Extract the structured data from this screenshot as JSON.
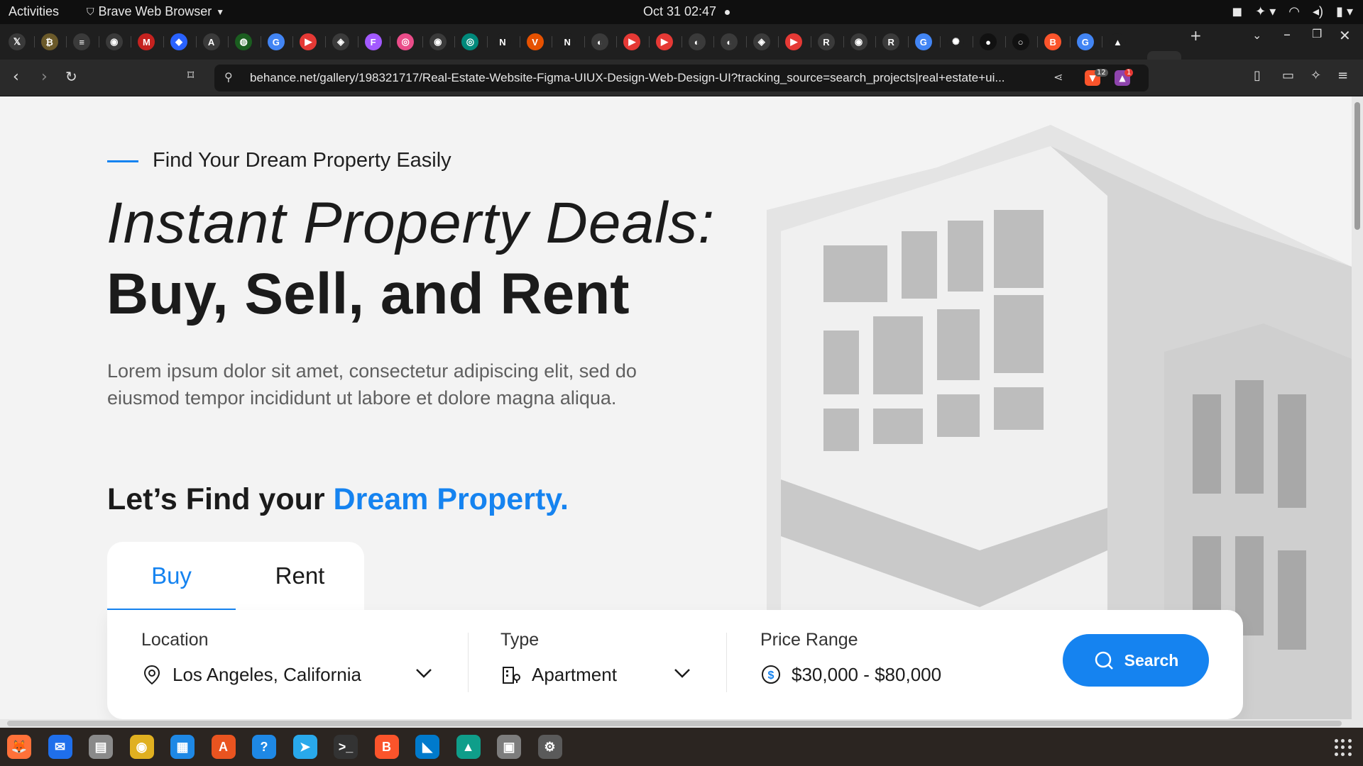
{
  "system_bar": {
    "activities": "Activities",
    "app_name": "Brave Web Browser",
    "clock": "Oct 31  02:47"
  },
  "browser": {
    "url": "behance.net/gallery/198321717/Real-Estate-Website-Figma-UIUX-Design-Web-Design-UI?tracking_source=search_projects|real+estate+ui...",
    "shields_count": "12",
    "rewards_count": "1",
    "close_tab_glyph": "✕",
    "new_tab_glyph": "+"
  },
  "tab_icons": [
    {
      "name": "x-icon",
      "glyph": "𝕏",
      "color": "#3a3a3a"
    },
    {
      "name": "coin-icon",
      "glyph": "₿",
      "color": "#6b5a2a"
    },
    {
      "name": "stack-icon",
      "glyph": "≡",
      "color": "#3a3a3a"
    },
    {
      "name": "chrome-icon",
      "glyph": "◉",
      "color": "#3a3a3a"
    },
    {
      "name": "gmail-icon",
      "glyph": "M",
      "color": "#c5221f"
    },
    {
      "name": "bluebird-icon",
      "glyph": "◆",
      "color": "#2962ff"
    },
    {
      "name": "circle-a-icon",
      "glyph": "A",
      "color": "#3a3a3a"
    },
    {
      "name": "green-icon",
      "glyph": "◍",
      "color": "#1b5e20"
    },
    {
      "name": "google-icon",
      "glyph": "G",
      "color": "#4285f4"
    },
    {
      "name": "youtube-icon",
      "glyph": "▶",
      "color": "#e53935"
    },
    {
      "name": "app-icon",
      "glyph": "◈",
      "color": "#3a3a3a"
    },
    {
      "name": "figma-icon",
      "glyph": "F",
      "color": "#a259ff"
    },
    {
      "name": "dribbble-icon",
      "glyph": "◎",
      "color": "#ea4c89"
    },
    {
      "name": "chrome-icon",
      "glyph": "◉",
      "color": "#3a3a3a"
    },
    {
      "name": "teal-icon",
      "glyph": "◎",
      "color": "#00897b"
    },
    {
      "name": "notion-icon",
      "glyph": "N",
      "color": "#1f1f1f"
    },
    {
      "name": "v-icon",
      "glyph": "V",
      "color": "#e65100"
    },
    {
      "name": "notion-icon",
      "glyph": "N",
      "color": "#1f1f1f"
    },
    {
      "name": "github-icon",
      "glyph": "◐",
      "color": "#3a3a3a"
    },
    {
      "name": "youtube-icon",
      "glyph": "▶",
      "color": "#e53935"
    },
    {
      "name": "youtube-icon",
      "glyph": "▶",
      "color": "#e53935"
    },
    {
      "name": "github-icon",
      "glyph": "◐",
      "color": "#3a3a3a"
    },
    {
      "name": "github-icon",
      "glyph": "◐",
      "color": "#3a3a3a"
    },
    {
      "name": "app-icon",
      "glyph": "◈",
      "color": "#3a3a3a"
    },
    {
      "name": "youtube-icon",
      "glyph": "▶",
      "color": "#e53935"
    },
    {
      "name": "r-icon",
      "glyph": "R",
      "color": "#3a3a3a"
    },
    {
      "name": "chrome-icon",
      "glyph": "◉",
      "color": "#3a3a3a"
    },
    {
      "name": "r-icon",
      "glyph": "R",
      "color": "#3a3a3a"
    },
    {
      "name": "google-icon",
      "glyph": "G",
      "color": "#4285f4"
    },
    {
      "name": "openai-icon",
      "glyph": "✺",
      "color": "#1f1f1f"
    },
    {
      "name": "dark-icon",
      "glyph": "●",
      "color": "#111111"
    },
    {
      "name": "dark-icon",
      "glyph": "○",
      "color": "#111111"
    },
    {
      "name": "brave-icon",
      "glyph": "B",
      "color": "#fb542b"
    },
    {
      "name": "google-icon",
      "glyph": "G",
      "color": "#4285f4"
    },
    {
      "name": "triangle-icon",
      "glyph": "▲",
      "color": "#1f1f1f"
    }
  ],
  "hero": {
    "eyebrow": "Find Your Dream Property Easily",
    "headline_italic": "Instant Property Deals:",
    "headline_bold": "Buy, Sell, and Rent",
    "paragraph": "Lorem ipsum dolor sit amet, consectetur adipiscing elit, sed do eiusmod tempor incididunt ut labore et dolore magna aliqua.",
    "find_prefix": "Let’s Find your ",
    "find_accent": "Dream Property."
  },
  "tabs": [
    {
      "label": "Buy",
      "active": true
    },
    {
      "label": "Rent",
      "active": false
    }
  ],
  "search": {
    "location_label": "Location",
    "location_value": "Los Angeles, California",
    "type_label": "Type",
    "type_value": "Apartment",
    "price_label": "Price Range",
    "price_value": "$30,000 - $80,000",
    "button_label": "Search"
  },
  "colors": {
    "accent": "#1583f0",
    "text": "#1b1b1b",
    "muted": "#5f5f5f",
    "page_bg": "#f3f3f3"
  },
  "dock": [
    {
      "name": "firefox-icon",
      "glyph": "🦊",
      "color": "#ff7139"
    },
    {
      "name": "thunderbird-icon",
      "glyph": "✉",
      "color": "#1f6feb"
    },
    {
      "name": "files-icon",
      "glyph": "▤",
      "color": "#8a8a8a"
    },
    {
      "name": "rhythmbox-icon",
      "glyph": "◉",
      "color": "#e0b020"
    },
    {
      "name": "writer-icon",
      "glyph": "▦",
      "color": "#1e88e5"
    },
    {
      "name": "appcenter-icon",
      "glyph": "A",
      "color": "#e95420"
    },
    {
      "name": "help-icon",
      "glyph": "?",
      "color": "#1e88e5"
    },
    {
      "name": "telegram-icon",
      "glyph": "➤",
      "color": "#29a9eb"
    },
    {
      "name": "terminal-icon",
      "glyph": ">_",
      "color": "#333333"
    },
    {
      "name": "brave-icon",
      "glyph": "B",
      "color": "#fb542b"
    },
    {
      "name": "vscode-icon",
      "glyph": "◣",
      "color": "#007acc"
    },
    {
      "name": "pycharm-icon",
      "glyph": "▲",
      "color": "#0f9e8a"
    },
    {
      "name": "screenshot-icon",
      "glyph": "▣",
      "color": "#7d7d7d"
    },
    {
      "name": "settings-icon",
      "glyph": "⚙",
      "color": "#5a5a5a"
    }
  ]
}
